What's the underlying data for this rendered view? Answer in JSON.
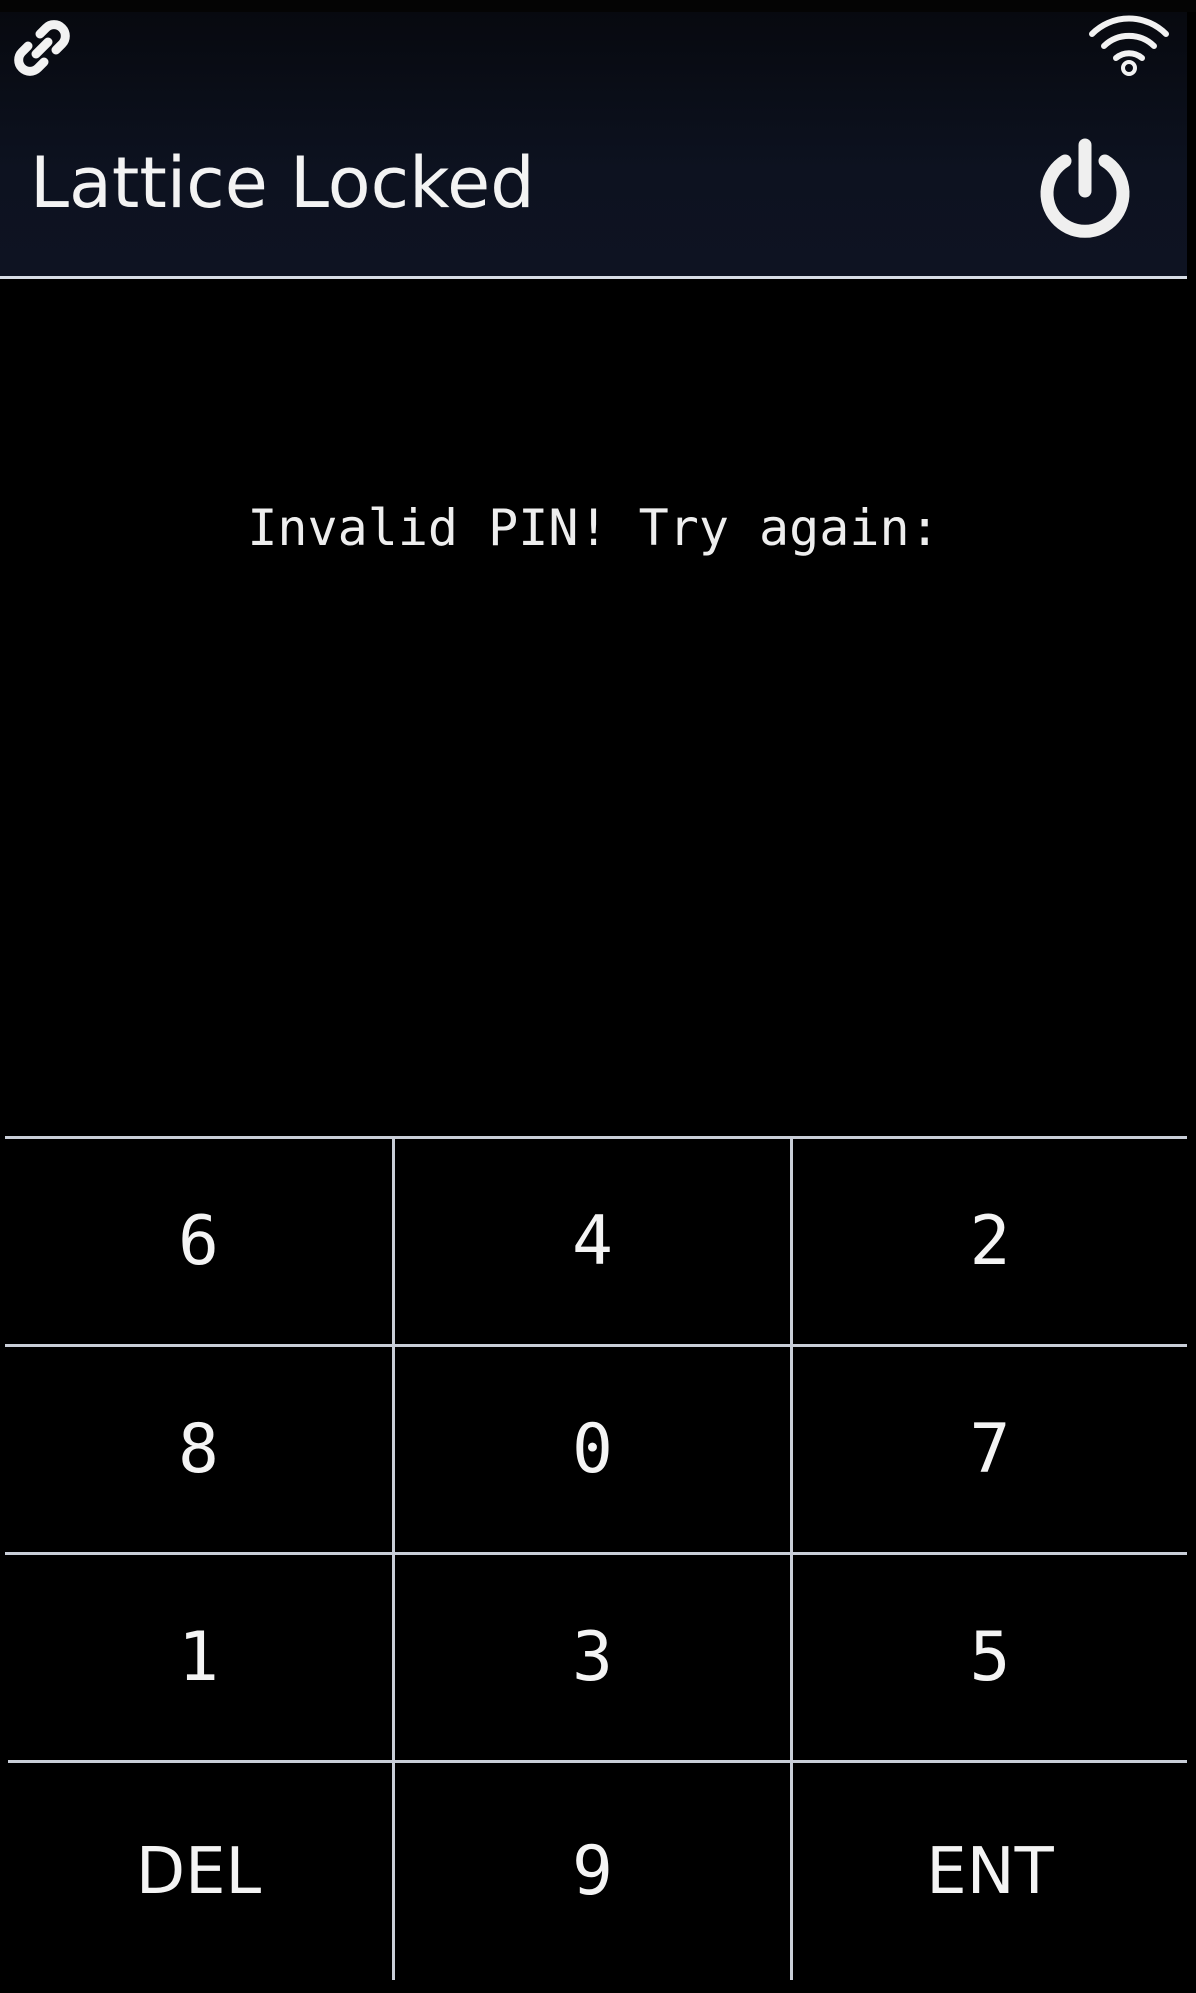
{
  "header": {
    "title": "Lattice Locked",
    "link_icon": "link-icon",
    "wifi_icon": "wifi-icon",
    "power_icon": "power-icon"
  },
  "main": {
    "status_message": "Invalid PIN! Try again:"
  },
  "keypad": {
    "rows": [
      [
        "6",
        "4",
        "2"
      ],
      [
        "8",
        "0",
        "7"
      ],
      [
        "1",
        "3",
        "5"
      ],
      [
        "DEL",
        "9",
        "ENT"
      ]
    ]
  },
  "colors": {
    "background": "#000000",
    "header_background": "#0d1220",
    "text": "#f2f2f2",
    "grid_lines": "#c9ced8"
  }
}
